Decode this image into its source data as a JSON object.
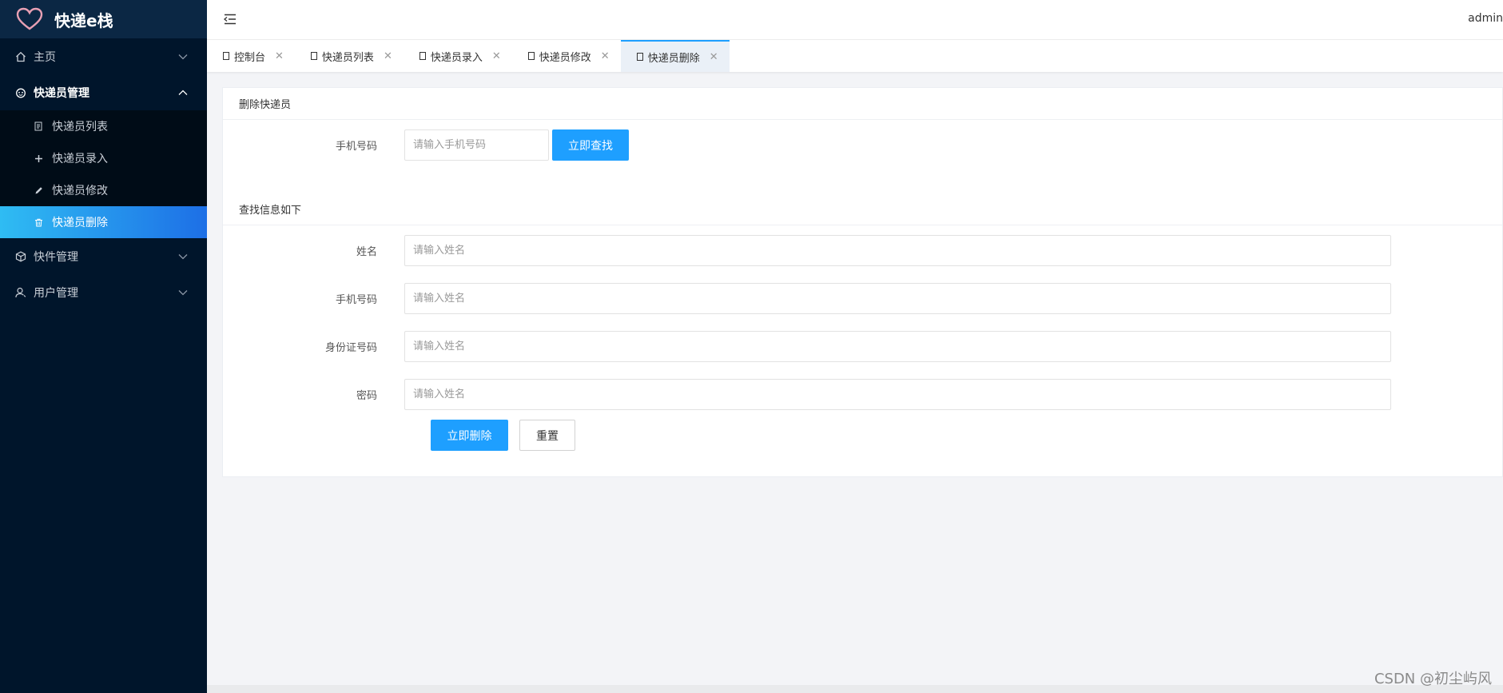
{
  "app": {
    "title": "快递e栈"
  },
  "header": {
    "user": "admin"
  },
  "sidebar": {
    "items": [
      {
        "label": "主页",
        "icon": "home-icon",
        "expanded": false
      },
      {
        "label": "快递员管理",
        "icon": "courier-icon",
        "expanded": true,
        "children": [
          {
            "label": "快递员列表",
            "icon": "list-doc-icon"
          },
          {
            "label": "快递员录入",
            "icon": "plus-icon"
          },
          {
            "label": "快递员修改",
            "icon": "pencil-icon"
          },
          {
            "label": "快递员删除",
            "icon": "trash-icon",
            "active": true
          }
        ]
      },
      {
        "label": "快件管理",
        "icon": "package-icon",
        "expanded": false
      },
      {
        "label": "用户管理",
        "icon": "user-icon",
        "expanded": false
      }
    ]
  },
  "tabs": [
    {
      "label": "控制台"
    },
    {
      "label": "快递员列表"
    },
    {
      "label": "快递员录入"
    },
    {
      "label": "快递员修改"
    },
    {
      "label": "快递员删除",
      "active": true
    }
  ],
  "search_section": {
    "title": "删除快递员",
    "phone_label": "手机号码",
    "phone_placeholder": "请输入手机号码",
    "search_button": "立即查找"
  },
  "result_section": {
    "title": "查找信息如下",
    "fields": [
      {
        "label": "姓名",
        "placeholder": "请输入姓名"
      },
      {
        "label": "手机号码",
        "placeholder": "请输入姓名"
      },
      {
        "label": "身份证号码",
        "placeholder": "请输入姓名"
      },
      {
        "label": "密码",
        "placeholder": "请输入姓名"
      }
    ],
    "delete_button": "立即删除",
    "reset_button": "重置"
  },
  "watermark": "CSDN @初尘屿风",
  "colors": {
    "sidebar_bg": "#00152b",
    "accent": "#1e9fff",
    "active_gradient_start": "#2fbcf3",
    "active_gradient_end": "#1d6fe6"
  }
}
